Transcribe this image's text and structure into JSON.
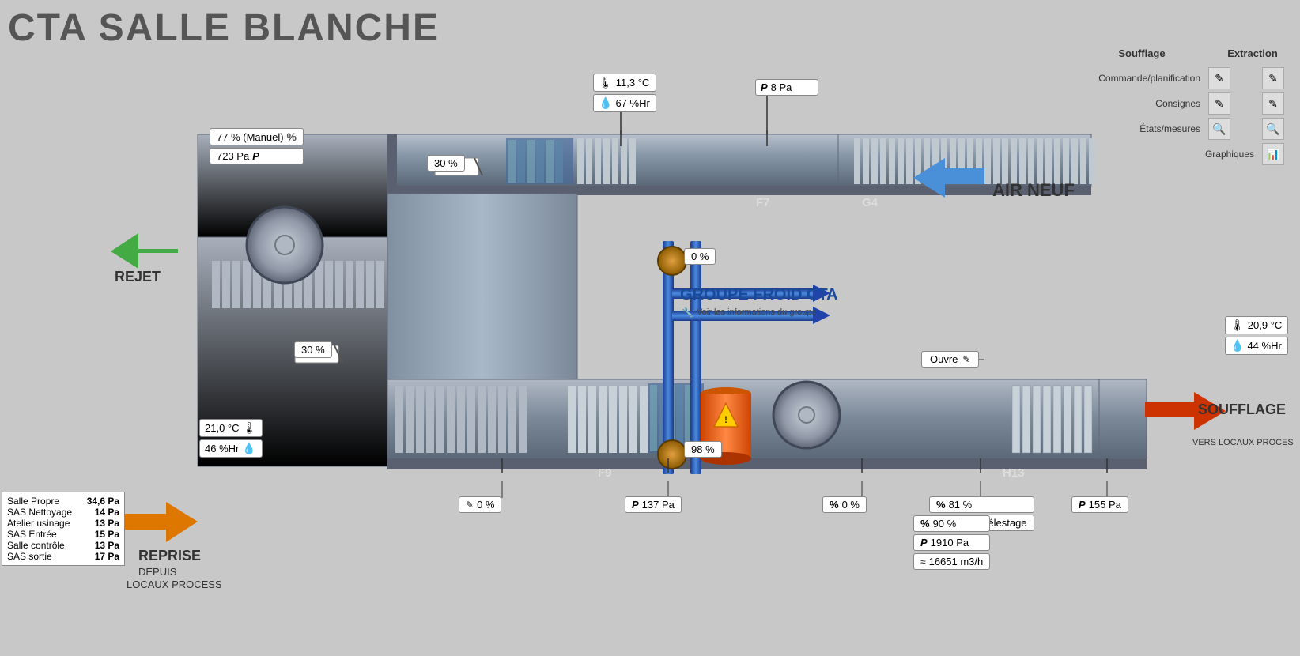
{
  "title": "CTA SALLE BLANCHE",
  "topRight": {
    "col1": "Soufflage",
    "col2": "Extraction",
    "rows": [
      {
        "label": "Commande/planification",
        "icon1": "edit",
        "icon2": "edit"
      },
      {
        "label": "Consignes",
        "icon1": "edit",
        "icon2": "edit"
      },
      {
        "label": "États/mesures",
        "icon1": "search",
        "icon2": "search"
      },
      {
        "label": "Graphiques",
        "icon1": "chart",
        "icon2": ""
      }
    ]
  },
  "sensors": {
    "top_temp": "11,3 °C",
    "top_hum": "67 %Hr",
    "top_pressure": "8 Pa",
    "soufflage_temp": "20,9 °C",
    "soufflage_hum": "44 %Hr",
    "reprise_temp": "21,0 °C",
    "reprise_hum": "46 %Hr"
  },
  "controls": {
    "fan_pct_manual": "77 % (Manuel)",
    "fan_pa": "723 Pa",
    "damper1_pct": "30 %",
    "damper2_pct": "30 %",
    "valve1_pct": "0 %",
    "valve2_pct": "98 %",
    "ouvre_btn": "Ouvre",
    "filter_pct_bottom": "0 %",
    "pressure_p137": "137 Pa",
    "motor_pct": "0 %",
    "h13_pct": "81 %",
    "h13_pa": "155 Pa",
    "load_pct": "90 %",
    "load_pa": "1910 Pa",
    "load_m3h": "16651 m3/h",
    "delestage": "Pas de délestage"
  },
  "labels": {
    "rejet": "REJET",
    "reprise": "REPRISE",
    "reprise_sub1": "DEPUIS",
    "reprise_sub2": "LOCAUX PROCESS",
    "soufflage": "SOUFFLAGE",
    "soufflage_sub": "VERS LOCAUX PROCES",
    "air_neuf": "AIR NEUF",
    "groupe_froid": "GROUPE FROID CTA",
    "groupe_froid_sub": "Voir les informations du groupe",
    "f7": "F7",
    "g4": "G4",
    "f9": "F9",
    "h13": "H13"
  },
  "pressureTable": {
    "items": [
      {
        "name": "Salle Propre",
        "value": "34,6 Pa"
      },
      {
        "name": "SAS Nettoyage",
        "value": "14 Pa"
      },
      {
        "name": "Atelier usinage",
        "value": "13 Pa"
      },
      {
        "name": "SAS Entrée",
        "value": "15 Pa"
      },
      {
        "name": "Salle contrôle",
        "value": "13 Pa"
      },
      {
        "name": "SAS sortie",
        "value": "17 Pa"
      }
    ]
  }
}
